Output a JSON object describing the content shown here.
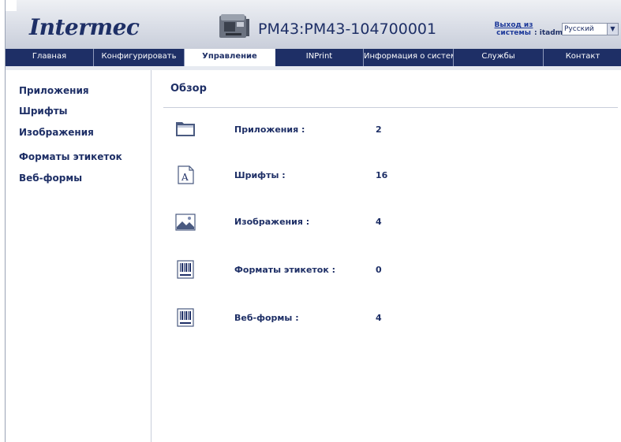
{
  "header": {
    "logo_text": "Intermec",
    "printer_name": "PM43:PM43-104700001",
    "logout": "Выход из системы",
    "logout_line1": "Выход из",
    "logout_line2": "системы",
    "user": ": itadmin",
    "language": "Русский"
  },
  "nav": {
    "items": [
      {
        "label": "Главная",
        "active": false
      },
      {
        "label": "Конфигурировать",
        "active": false
      },
      {
        "label": "Управление",
        "active": true
      },
      {
        "label": "INPrint",
        "active": false
      },
      {
        "label": "Информация о системе",
        "active": false
      },
      {
        "label": "Службы",
        "active": false
      },
      {
        "label": "Контакт",
        "active": false
      }
    ]
  },
  "sidebar": {
    "items": [
      {
        "label": "Приложения"
      },
      {
        "label": "Шрифты"
      },
      {
        "label": "Изображения"
      },
      {
        "label": "Форматы этикеток"
      },
      {
        "label": "Веб-формы"
      }
    ]
  },
  "main": {
    "title": "Обзор",
    "rows": [
      {
        "icon": "folder-icon",
        "label": "Приложения :",
        "value": "2"
      },
      {
        "icon": "font-icon",
        "label": "Шрифты :",
        "value": "16"
      },
      {
        "icon": "image-icon",
        "label": "Изображения :",
        "value": "4"
      },
      {
        "icon": "barcode-format-icon",
        "label": "Форматы этикеток :",
        "value": "0"
      },
      {
        "icon": "barcode-format-icon",
        "label": "Веб-формы :",
        "value": "4"
      }
    ]
  },
  "colors": {
    "brand": "#1e2f66",
    "nav_bg": "#1e2f66",
    "link": "#1e3a9a"
  }
}
